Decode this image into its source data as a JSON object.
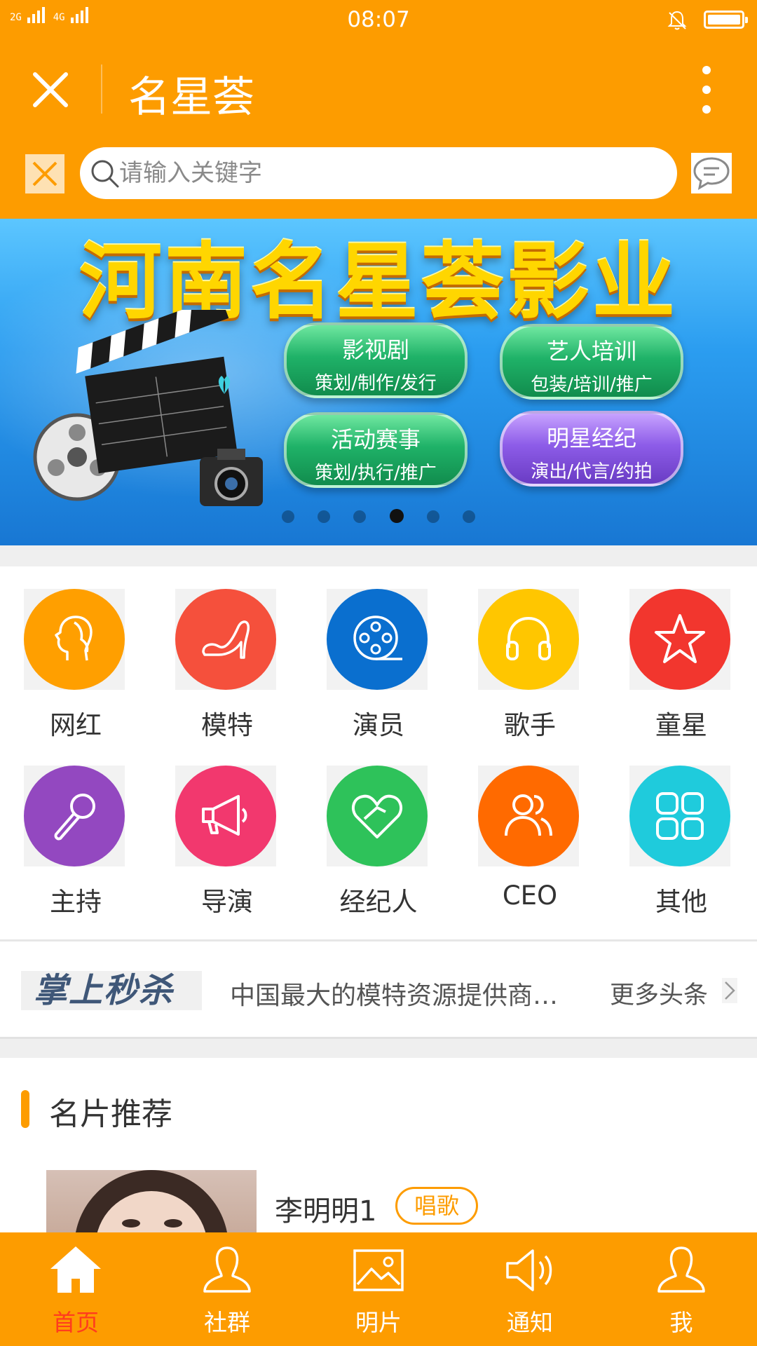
{
  "status_bar": {
    "signal_1": "2G",
    "signal_2": "4G",
    "time": "08:07"
  },
  "header": {
    "title": "名星荟"
  },
  "search": {
    "placeholder": "请输入关键字"
  },
  "banner": {
    "title": "河南名星荟影业",
    "pills": [
      {
        "title": "影视剧",
        "sub": "策划/制作/发行"
      },
      {
        "title": "艺人培训",
        "sub": "包装/培训/推广"
      },
      {
        "title": "活动赛事",
        "sub": "策划/执行/推广"
      },
      {
        "title": "明星经纪",
        "sub": "演出/代言/约拍"
      }
    ],
    "page_count": 6,
    "active_page": 4
  },
  "categories": [
    {
      "label": "网红",
      "icon": "female-head-icon",
      "color": "#ff9f00"
    },
    {
      "label": "模特",
      "icon": "high-heel-icon",
      "color": "#f5503c"
    },
    {
      "label": "演员",
      "icon": "film-reel-icon",
      "color": "#0a6fcf"
    },
    {
      "label": "歌手",
      "icon": "headphones-icon",
      "color": "#ffc600"
    },
    {
      "label": "童星",
      "icon": "star-icon",
      "color": "#f2362e"
    },
    {
      "label": "主持",
      "icon": "microphone-icon",
      "color": "#9348c0"
    },
    {
      "label": "导演",
      "icon": "megaphone-icon",
      "color": "#f2386e"
    },
    {
      "label": "经纪人",
      "icon": "heart-icon",
      "color": "#2ec25a"
    },
    {
      "label": "CEO",
      "icon": "people-icon",
      "color": "#ff6a00"
    },
    {
      "label": "其他",
      "icon": "grid-icon",
      "color": "#1fcbdc"
    }
  ],
  "ticker": {
    "logo_text": "掌上秒杀",
    "headline": "中国最大的模特资源提供商…",
    "more": "更多头条"
  },
  "section": {
    "title": "名片推荐",
    "card": {
      "name": "李明明1",
      "tag": "唱歌"
    }
  },
  "tabs": [
    {
      "label": "首页",
      "icon": "home-icon",
      "active": true
    },
    {
      "label": "社群",
      "icon": "person-icon",
      "active": false
    },
    {
      "label": "明片",
      "icon": "picture-icon",
      "active": false
    },
    {
      "label": "通知",
      "icon": "speaker-icon",
      "active": false
    },
    {
      "label": "我",
      "icon": "user-icon",
      "active": false
    }
  ],
  "colors": {
    "brand": "#fd9c00",
    "active_tab": "#ff3c1e"
  }
}
